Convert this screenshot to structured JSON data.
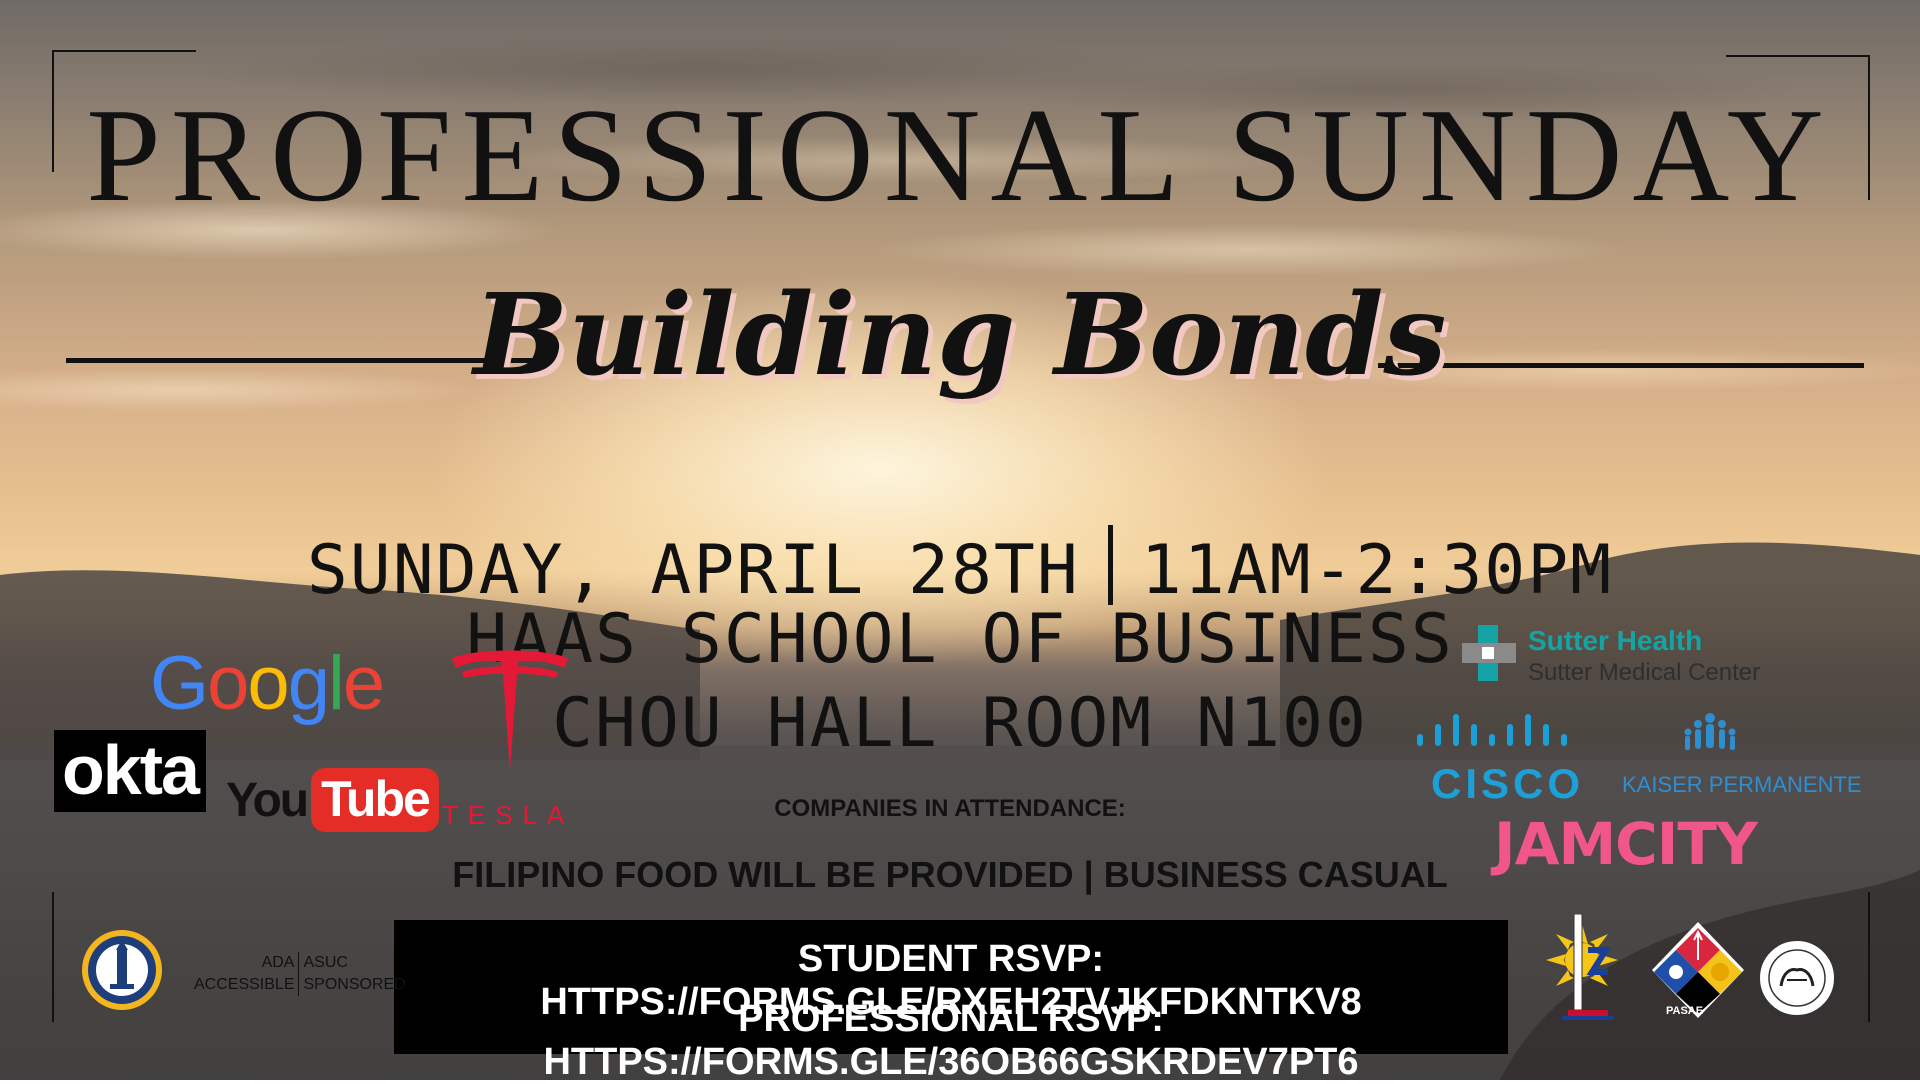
{
  "event": {
    "title": "PROFESSIONAL SUNDAY",
    "subtitle": "Building Bonds",
    "date": "SUNDAY, APRIL 28TH",
    "time": "11AM-2:30PM",
    "venue": "HAAS SCHOOL OF BUSINESS",
    "room": "CHOU HALL ROOM N100",
    "companies_label": "COMPANIES IN ATTENDANCE:",
    "food_note": "FILIPINO FOOD WILL BE PROVIDED | BUSINESS CASUAL"
  },
  "rsvp": {
    "student": "STUDENT RSVP: HTTPS://FORMS.GLE/RXEH2TVJKFDKNTKV8",
    "professional": "PROFESSIONAL RSVP: HTTPS://FORMS.GLE/36OB66GSKRDEV7PT6"
  },
  "companies": {
    "google": "Google",
    "okta": "okta",
    "youtube_you": "You",
    "youtube_tube": "Tube",
    "tesla": "TESLA",
    "sutter_name": "Sutter Health",
    "sutter_sub": "Sutter Medical Center",
    "cisco": "CISCO",
    "kaiser": "KAISER PERMANENTE",
    "jamcity": "JAMCITY"
  },
  "sponsor": {
    "ada_left": "ADA",
    "ada_right": "ASUC",
    "accessible": "ACCESSIBLE",
    "sponsored": "SPONSORED"
  },
  "org_logos": {
    "pasae": "PASAE"
  },
  "colors": {
    "google_blue": "#4285F4",
    "google_red": "#EA4335",
    "google_yellow": "#FBBC05",
    "google_green": "#34A853",
    "youtube_red": "#e52d27",
    "tesla_red": "#e31937",
    "sutter_teal": "#16a3a3",
    "cisco_blue": "#1ba0d7",
    "kaiser_blue": "#2f8ed0",
    "jamcity_pink": "#f0568a",
    "rsvp_bg": "#000000"
  }
}
